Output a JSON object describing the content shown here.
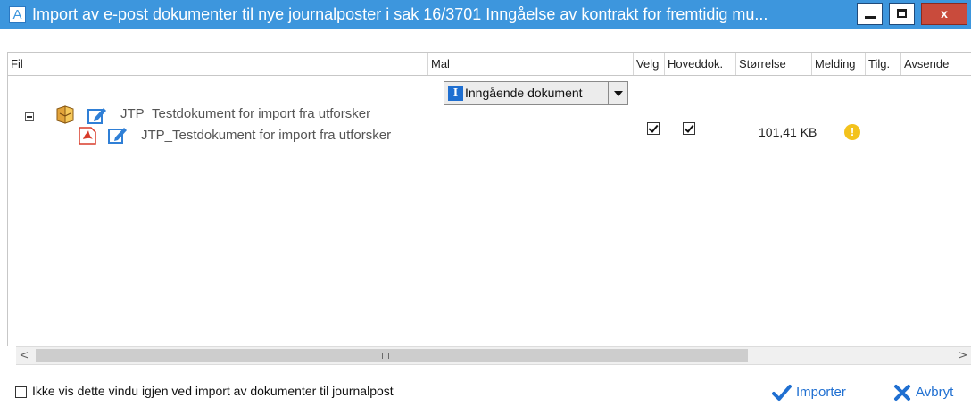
{
  "window": {
    "title": "Import av e-post dokumenter til nye journalposter i sak 16/3701 Inngåelse av kontrakt for fremtidig mu...",
    "app_icon_letter": "A",
    "close_glyph": "x"
  },
  "grid": {
    "columns": [
      "Fil",
      "Mal",
      "Velg",
      "Hoveddok.",
      "Størrelse",
      "Melding",
      "Tilg.",
      "Avsende"
    ],
    "rows": [
      {
        "type": "email",
        "expanded": true,
        "file_name": "JTP_Testdokument for import fra utforsker",
        "template": "Inngående dokument",
        "template_icon_letter": "I"
      },
      {
        "type": "pdf",
        "file_name": "JTP_Testdokument for import fra utforsker",
        "select": true,
        "main_document": true,
        "size": "101,41 KB",
        "message_icon": "warning-icon",
        "message_glyph": "!"
      }
    ]
  },
  "scrollbar": {
    "left_arrow": "<",
    "right_arrow": ">"
  },
  "footer": {
    "dont_show_again_checked": false,
    "dont_show_again_label": "Ikke vis dette vindu igjen ved import av dokumenter til journalpost",
    "import_label": "Importer",
    "cancel_label": "Avbryt"
  },
  "colors": {
    "titlebar": "#3d96dd",
    "close_button": "#c94b3c",
    "accent": "#1f6fd1",
    "warning": "#f3c21c",
    "pdf": "#d83b2a"
  }
}
